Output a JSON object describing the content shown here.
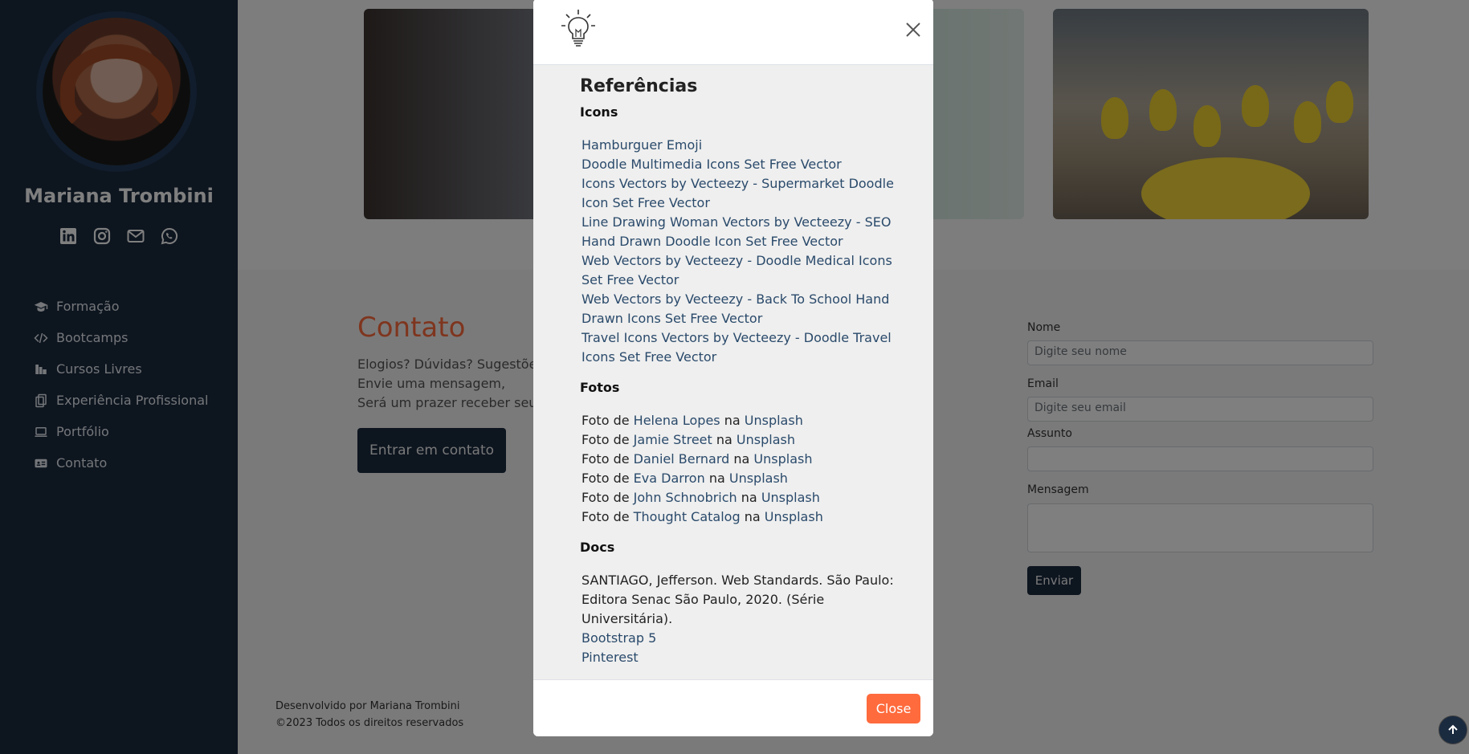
{
  "sidebar": {
    "name": "Mariana Trombini",
    "social": [
      "linkedin-icon",
      "instagram-icon",
      "mail-icon",
      "whatsapp-icon"
    ],
    "items": [
      {
        "label": "Formação",
        "icon": "graduation-cap-icon"
      },
      {
        "label": "Bootcamps",
        "icon": "code-icon"
      },
      {
        "label": "Cursos Livres",
        "icon": "books-icon"
      },
      {
        "label": "Experiência Profissional",
        "icon": "briefcase-icon"
      },
      {
        "label": "Portfólio",
        "icon": "laptop-icon"
      },
      {
        "label": "Contato",
        "icon": "id-card-icon"
      }
    ]
  },
  "contato": {
    "title": "Contato",
    "line1": "Elogios? Dúvidas? Sugestões?",
    "line2": "Envie uma mensagem,",
    "line3": "Será um prazer receber seu fe",
    "button": "Entrar em contato"
  },
  "form": {
    "name_label": "Nome",
    "name_placeholder": "Digite seu nome",
    "email_label": "Email",
    "email_placeholder": "Digite seu email",
    "subject_label": "Assunto",
    "message_label": "Mensagem",
    "submit": "Enviar"
  },
  "footer": {
    "line1": "Desenvolvido por Mariana Trombini",
    "line2": "©2023 Todos os direitos reservados"
  },
  "modal": {
    "title": "Referências",
    "icons_heading": "Icons",
    "icons": [
      "Hamburguer Emoji",
      "Doodle Multimedia Icons Set Free Vector",
      "Icons Vectors by Vecteezy - Supermarket Doodle Icon Set Free Vector",
      "Line Drawing Woman Vectors by Vecteezy - SEO Hand Drawn Doodle Icon Set Free Vector",
      "Web Vectors by Vecteezy - Doodle Medical Icons Set Free Vector",
      "Web Vectors by Vecteezy - Back To School Hand Drawn Icons Set Free Vector",
      "Travel Icons Vectors by Vecteezy - Doodle Travel Icons Set Free Vector"
    ],
    "photos_heading": "Fotos",
    "photo_prefix": "Foto de",
    "photo_mid": "na",
    "photo_source": "Unsplash",
    "photos": [
      "Helena Lopes",
      "Jamie Street",
      "Daniel Bernard",
      "Eva Darron",
      "John Schnobrich",
      "Thought Catalog"
    ],
    "docs_heading": "Docs",
    "doc_citation": "SANTIAGO, Jefferson. Web Standards. São Paulo: Editora Senac São Paulo, 2020. (Série Universitária).",
    "doc_links": [
      "Bootstrap 5",
      "Pinterest"
    ],
    "close_label": "Close"
  },
  "colors": {
    "sidebar": "#1a2a3f",
    "accent": "#ff6b3d",
    "link": "#2a4a6b"
  }
}
